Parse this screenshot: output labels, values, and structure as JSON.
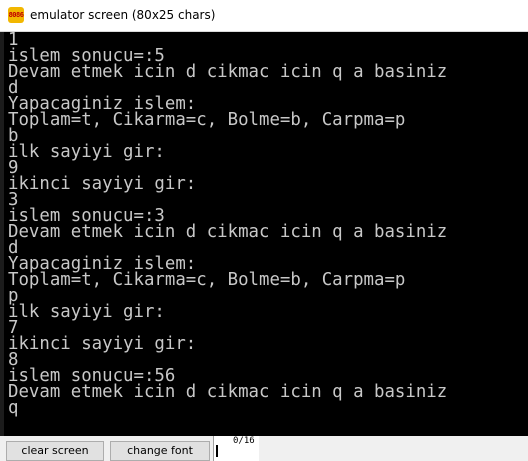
{
  "window": {
    "title": "emulator screen (80x25 chars)",
    "icon_text": "8086"
  },
  "screen": {
    "lines": [
      "1",
      "islem sonucu=:5",
      "Devam etmek icin d cikmac icin q a basiniz",
      "d",
      "Yapacaginiz islem:",
      "Toplam=t, Cikarma=c, Bolme=b, Carpma=p",
      "b",
      "ilk sayiyi gir:",
      "9",
      "ikinci sayiyi gir:",
      "3",
      "islem sonucu=:3",
      "Devam etmek icin d cikmac icin q a basiniz",
      "d",
      "Yapacaginiz islem:",
      "Toplam=t, Cikarma=c, Bolme=b, Carpma=p",
      "p",
      "ilk sayiyi gir:",
      "7",
      "ikinci sayiyi gir:",
      "8",
      "islem sonucu=:56",
      "Devam etmek icin d cikmac icin q a basiniz",
      "q"
    ]
  },
  "bottom_bar": {
    "clear_label": "clear screen",
    "font_label": "change font",
    "counter": "0/16"
  },
  "colors": {
    "screen_bg": "#000000",
    "screen_text": "#c8c8c8",
    "button_bg": "#e1e1e1"
  }
}
